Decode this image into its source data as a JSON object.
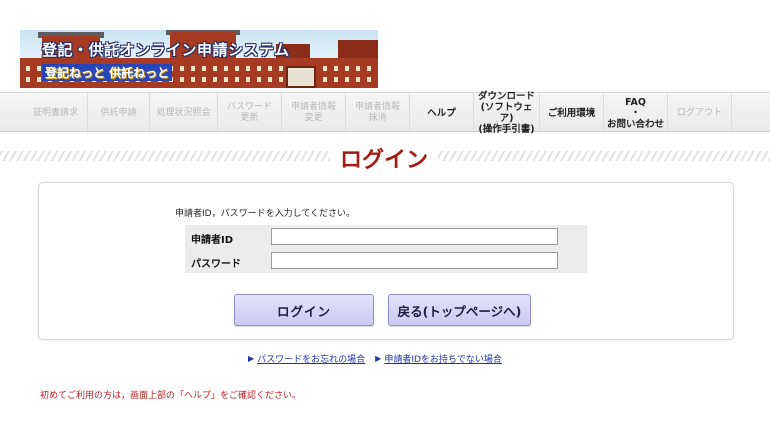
{
  "banner": {
    "title": "登記・供託オンライン申請システム",
    "subtitle": "登記ねっと 供託ねっと"
  },
  "nav": {
    "items": [
      {
        "label": "証明書請求",
        "enabled": false
      },
      {
        "label": "供託申請",
        "enabled": false
      },
      {
        "label": "処理状況照会",
        "enabled": false
      },
      {
        "label": "パスワード\n更新",
        "enabled": false
      },
      {
        "label": "申請者情報\n変更",
        "enabled": false
      },
      {
        "label": "申請者情報\n抹消",
        "enabled": false
      },
      {
        "label": "ヘルプ",
        "enabled": true
      },
      {
        "label": "ダウンロード\n(ソフトウェア)\n(操作手引書)",
        "enabled": true
      },
      {
        "label": "ご利用環境",
        "enabled": true
      },
      {
        "label": "FAQ\n・\nお問い合わせ",
        "enabled": true
      },
      {
        "label": "ログアウト",
        "enabled": false
      }
    ]
  },
  "page": {
    "title": "ログイン"
  },
  "form": {
    "instruction": "申請者ID，パスワードを入力してください。",
    "applicant_id_label": "申請者ID",
    "applicant_id_value": "",
    "password_label": "パスワード",
    "password_value": ""
  },
  "buttons": {
    "login": "ログイン",
    "back": "戻る(トップページへ)"
  },
  "links": {
    "forgot_password": "パスワードをお忘れの場合",
    "no_applicant_id": "申請者IDをお持ちでない場合"
  },
  "notice": "初めてご利用の方は，画面上部の「ヘルプ」をご確認ください。"
}
